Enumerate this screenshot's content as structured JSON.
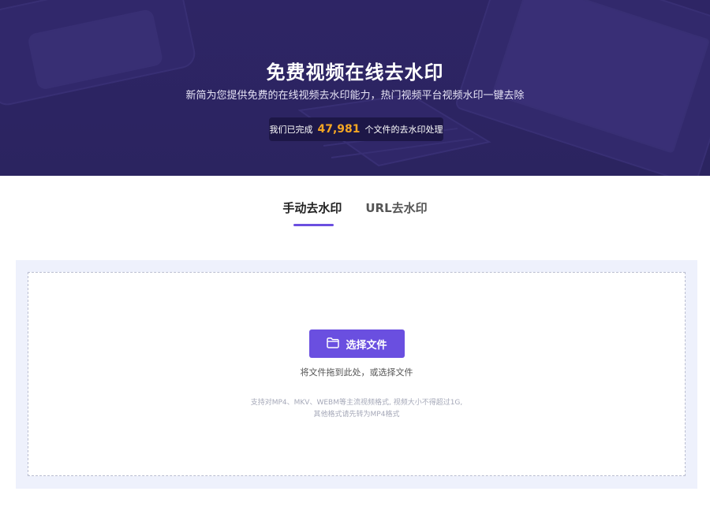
{
  "hero": {
    "title": "免费视频在线去水印",
    "subtitle": "新简为您提供免费的在线视频去水印能力，热门视频平台视频水印一键去除",
    "stat_prefix": "我们已完成",
    "stat_number": "47,981",
    "stat_suffix": "个文件的去水印处理",
    "bg_color": "#2e2565",
    "accent_number_color": "#f5a623"
  },
  "tabs": [
    {
      "label": "手动去水印",
      "active": true
    },
    {
      "label": "URL去水印",
      "active": false
    }
  ],
  "upload": {
    "button_label": "选择文件",
    "button_icon": "folder-icon",
    "button_color": "#6a4fe0",
    "drag_hint": "将文件拖到此处，或选择文件",
    "support_line1": "支持对MP4、MKV、WEBM等主流视频格式, 视频大小不得超过1G,",
    "support_line2": "其他格式请先转为MP4格式"
  }
}
